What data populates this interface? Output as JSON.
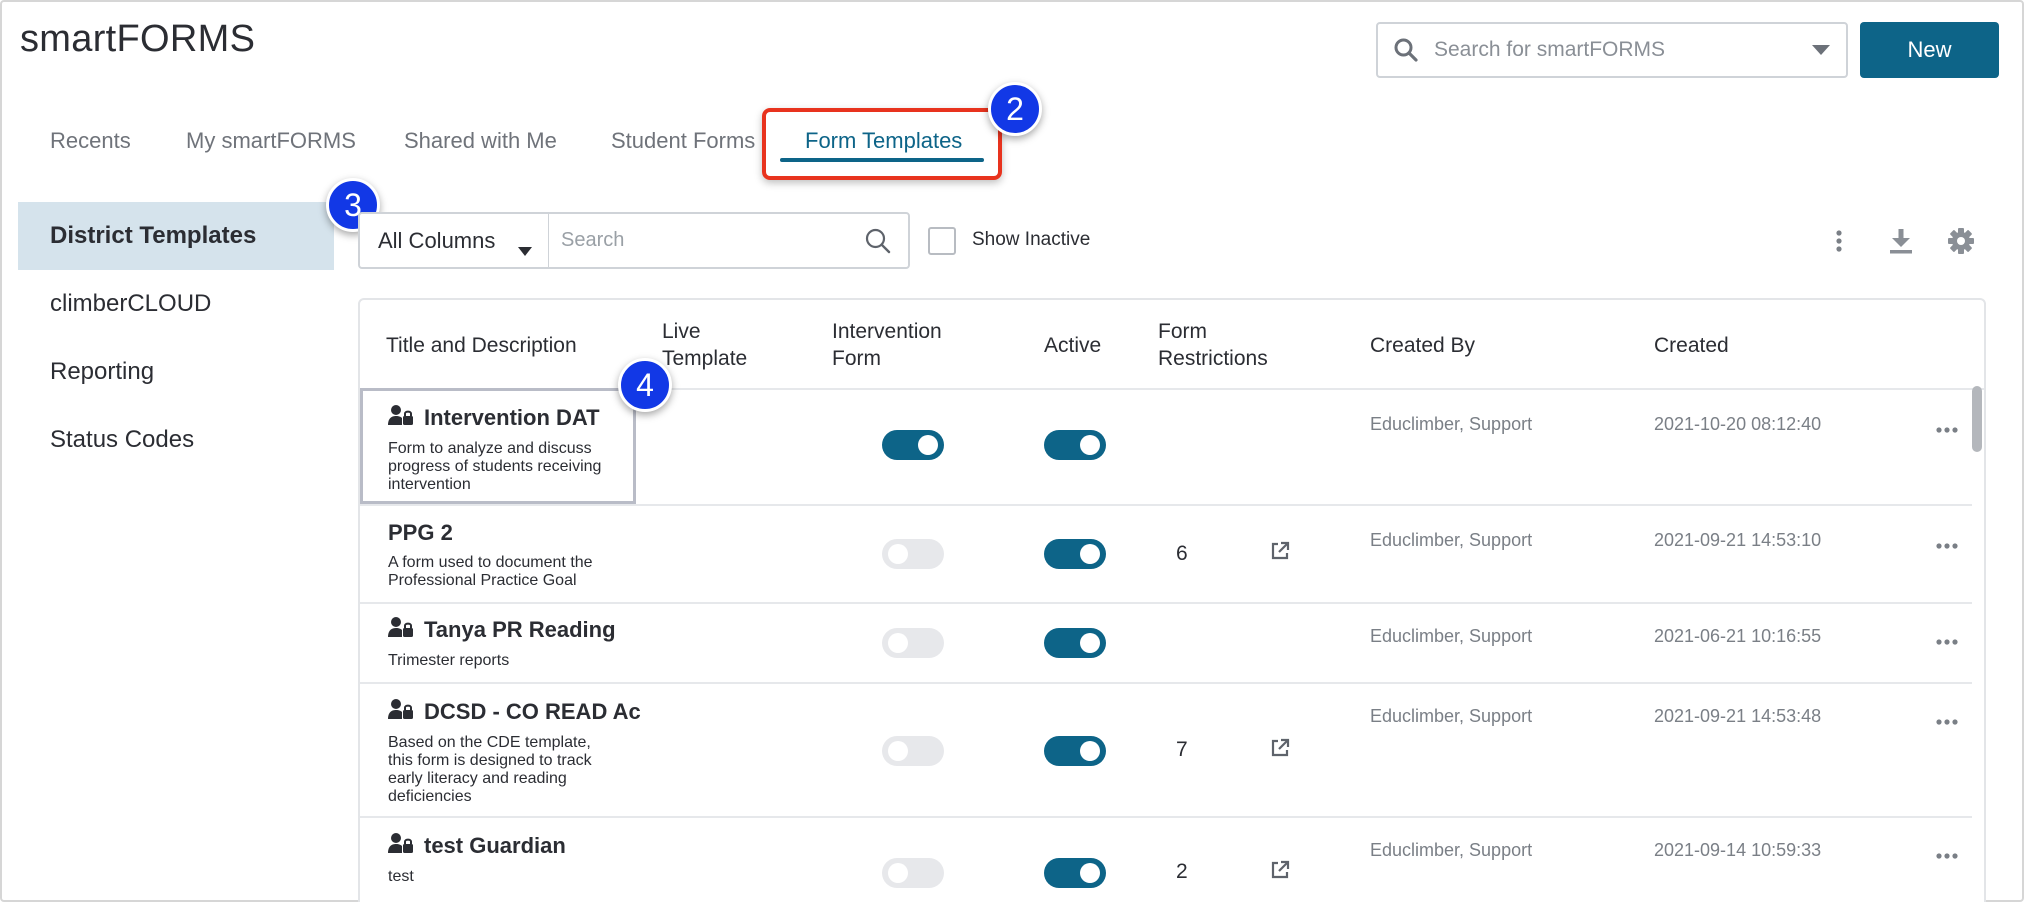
{
  "app": {
    "title": "smartFORMS"
  },
  "header": {
    "search_placeholder": "Search for smartFORMS",
    "new_label": "New"
  },
  "tabs": [
    {
      "label": "Recents",
      "active": false
    },
    {
      "label": "My smartFORMS",
      "active": false
    },
    {
      "label": "Shared with Me",
      "active": false
    },
    {
      "label": "Student Forms",
      "active": false
    },
    {
      "label": "Form Templates",
      "active": true
    }
  ],
  "sidebar": {
    "items": [
      {
        "label": "District Templates",
        "active": true
      },
      {
        "label": "climberCLOUD",
        "active": false
      },
      {
        "label": "Reporting",
        "active": false
      },
      {
        "label": "Status Codes",
        "active": false
      }
    ]
  },
  "toolbar": {
    "column_filter": "All Columns",
    "search_placeholder": "Search",
    "show_inactive_label": "Show Inactive",
    "show_inactive_checked": false
  },
  "callouts": [
    "2",
    "3",
    "4"
  ],
  "table": {
    "headers": {
      "title": "Title and Description",
      "live_line1": "Live",
      "live_line2": "Template",
      "intervention_line1": "Intervention",
      "intervention_line2": "Form",
      "active": "Active",
      "restrictions_line1": "Form",
      "restrictions_line2": "Restrictions",
      "created_by": "Created By",
      "created": "Created"
    },
    "rows": [
      {
        "title": "Intervention DAT",
        "locked": true,
        "description": "Form to analyze and discuss progress of students receiving intervention",
        "intervention": true,
        "active": true,
        "restrictions": "",
        "created_by": "Educlimber, Support",
        "created": "2021-10-20 08:12:40"
      },
      {
        "title": "PPG 2",
        "locked": false,
        "description": "A form used to document the Professional Practice Goal",
        "intervention": false,
        "active": true,
        "restrictions": "6",
        "created_by": "Educlimber, Support",
        "created": "2021-09-21 14:53:10"
      },
      {
        "title": "Tanya PR Reading",
        "locked": true,
        "description": "Trimester reports",
        "intervention": false,
        "active": true,
        "restrictions": "",
        "created_by": "Educlimber, Support",
        "created": "2021-06-21 10:16:55"
      },
      {
        "title": "DCSD - CO READ Ac",
        "locked": true,
        "description": "Based on the CDE template, this form is designed to track early literacy and reading deficiencies",
        "intervention": false,
        "active": true,
        "restrictions": "7",
        "created_by": "Educlimber, Support",
        "created": "2021-09-21 14:53:48"
      },
      {
        "title": "test Guardian",
        "locked": true,
        "description": "test",
        "intervention": false,
        "active": true,
        "restrictions": "2",
        "created_by": "Educlimber, Support",
        "created": "2021-09-14 10:59:33"
      }
    ]
  },
  "colors": {
    "accent": "#0d6488",
    "callout_box": "#e8331e",
    "callout_badge": "#1238e6",
    "sidebar_active_bg": "#d5e3ec"
  },
  "icons": {
    "search": "search-icon",
    "dropdown": "chevron-down-icon",
    "more_vertical": "more-vertical-icon",
    "download": "download-icon",
    "settings": "gear-icon",
    "lock_user": "user-lock-icon",
    "external_link": "external-link-icon",
    "more_horizontal": "more-horizontal-icon"
  }
}
